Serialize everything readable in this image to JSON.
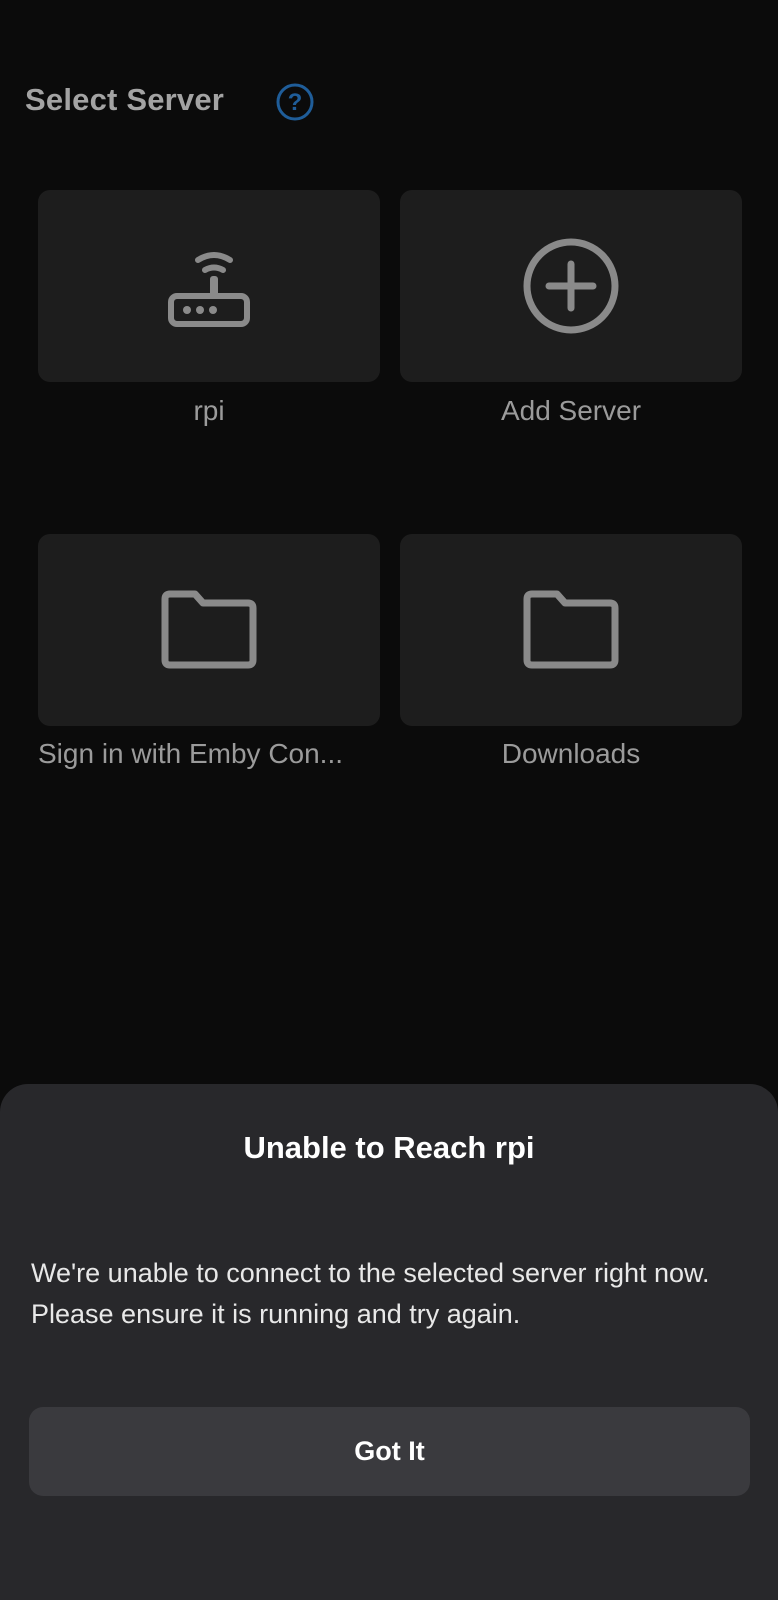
{
  "header": {
    "title": "Select Server",
    "help_icon": "question-circle-icon",
    "help_icon_color": "#1f5d99"
  },
  "servers": [
    {
      "label": "rpi",
      "icon": "router-wifi-icon"
    },
    {
      "label": "Add Server",
      "icon": "add-circle-icon"
    },
    {
      "label": "Sign in with Emby Con...",
      "icon": "folder-icon"
    },
    {
      "label": "Downloads",
      "icon": "folder-icon"
    }
  ],
  "dialog": {
    "title": "Unable to Reach rpi",
    "message": "We're unable to connect to the selected server right now. Please ensure it is running and try again.",
    "button_label": "Got It"
  },
  "colors": {
    "background": "#0b0b0b",
    "tile": "#1d1d1d",
    "icon": "#8a8a8a",
    "sheet": "#28282b",
    "button": "#3a3a3e"
  }
}
